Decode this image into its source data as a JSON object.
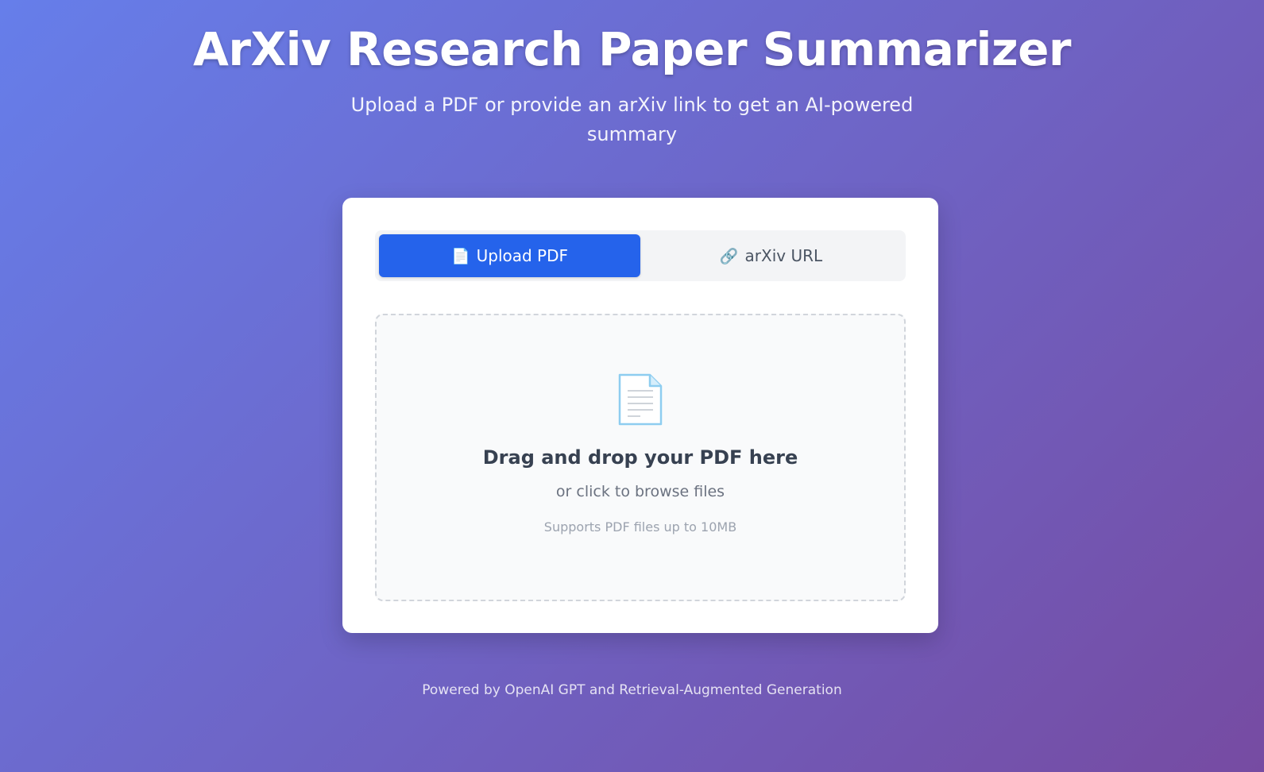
{
  "header": {
    "title": "ArXiv Research Paper Summarizer",
    "subtitle": "Upload a PDF or provide an arXiv link to get an AI-powered summary"
  },
  "tabs": [
    {
      "label": "Upload PDF",
      "icon": "document-icon",
      "active": true
    },
    {
      "label": "arXiv URL",
      "icon": "link-icon",
      "active": false
    }
  ],
  "dropzone": {
    "icon": "document-icon",
    "title": "Drag and drop your PDF here",
    "subtitle": "or click to browse files",
    "note": "Supports PDF files up to 10MB"
  },
  "footer": {
    "text": "Powered by OpenAI GPT and Retrieval-Augmented Generation"
  },
  "colors": {
    "gradient_start": "#667eea",
    "gradient_end": "#764ba2",
    "accent": "#2563eb"
  }
}
